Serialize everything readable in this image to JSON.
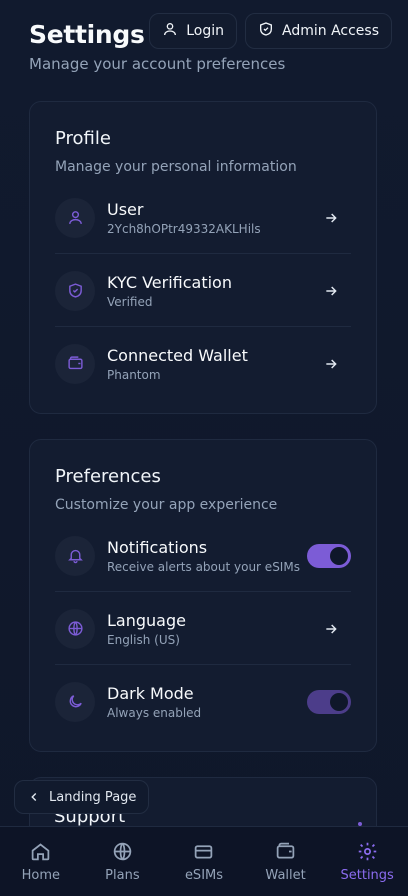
{
  "header": {
    "title": "Settings",
    "subtitle": "Manage your account preferences"
  },
  "top_actions": {
    "login": "Login",
    "admin": "Admin Access"
  },
  "profile": {
    "title": "Profile",
    "subtitle": "Manage your personal information",
    "items": [
      {
        "title": "User",
        "subtitle": "2Ych8hOPtr49332AKLHils",
        "icon": "user-icon"
      },
      {
        "title": "KYC Verification",
        "subtitle": "Verified",
        "icon": "shield-check-icon"
      },
      {
        "title": "Connected Wallet",
        "subtitle": "Phantom",
        "icon": "wallet-icon"
      }
    ]
  },
  "preferences": {
    "title": "Preferences",
    "subtitle": "Customize your app experience",
    "items": [
      {
        "title": "Notifications",
        "subtitle": "Receive alerts about your eSIMs",
        "icon": "bell-icon",
        "toggle": true
      },
      {
        "title": "Language",
        "subtitle": "English (US)",
        "icon": "globe-icon"
      },
      {
        "title": "Dark Mode",
        "subtitle": "Always enabled",
        "icon": "moon-icon",
        "toggle": true
      }
    ]
  },
  "support": {
    "title": "Support"
  },
  "landing_button": "Landing Page",
  "nav": [
    {
      "label": "Home",
      "icon": "home-icon"
    },
    {
      "label": "Plans",
      "icon": "globe-icon"
    },
    {
      "label": "eSIMs",
      "icon": "card-icon"
    },
    {
      "label": "Wallet",
      "icon": "wallet-icon"
    },
    {
      "label": "Settings",
      "icon": "gear-icon",
      "active": true
    }
  ],
  "colors": {
    "accent": "#7c5cd6",
    "background": "#0f172a",
    "card": "#131c30"
  }
}
